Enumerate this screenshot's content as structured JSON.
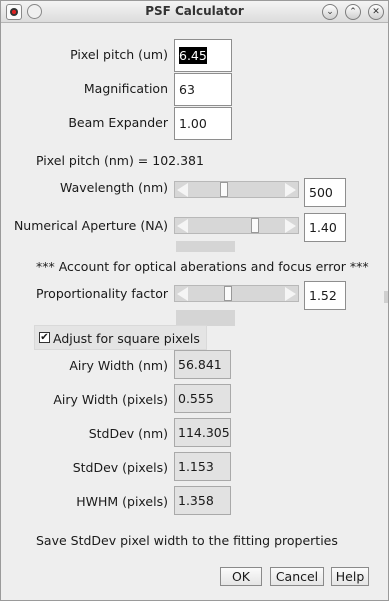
{
  "window": {
    "title": "PSF Calculator"
  },
  "fields": {
    "pixel_pitch_um": {
      "label": "Pixel pitch (um)",
      "value": "6.45"
    },
    "magnification": {
      "label": "Magnification",
      "value": "63"
    },
    "beam_expander": {
      "label": "Beam Expander",
      "value": "1.00"
    }
  },
  "computed": {
    "pixel_pitch_nm": "Pixel pitch (nm) = 102.381"
  },
  "sliders": {
    "wavelength": {
      "label": "Wavelength (nm)",
      "value": "500",
      "position": 0.36
    },
    "numerical_aperture": {
      "label": "Numerical Aperture (NA)",
      "value": "1.40",
      "position": 0.71
    },
    "proportionality": {
      "label": "Proportionality factor",
      "value": "1.52",
      "position": 0.4
    }
  },
  "notice": "*** Account for optical aberations and focus error ***",
  "square_pixels": {
    "label": "Adjust for square pixels",
    "checked": true
  },
  "results": [
    {
      "label": "Airy Width (nm)",
      "value": "56.841"
    },
    {
      "label": "Airy Width (pixels)",
      "value": "0.555"
    },
    {
      "label": "StdDev (nm)",
      "value": "114.305"
    },
    {
      "label": "StdDev (pixels)",
      "value": "1.153"
    },
    {
      "label": "HWHM (pixels)",
      "value": "1.358"
    }
  ],
  "save_note": "Save StdDev pixel width to the fitting properties",
  "buttons": {
    "ok": "OK",
    "cancel": "Cancel",
    "help": "Help"
  }
}
